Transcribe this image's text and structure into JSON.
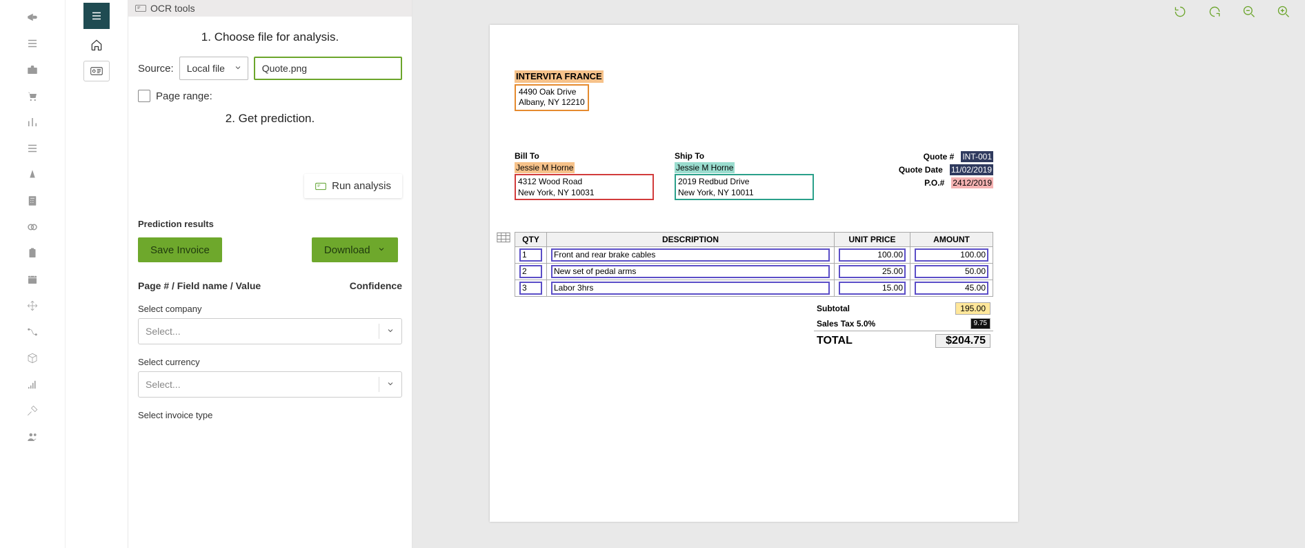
{
  "rail": {
    "icons": [
      "megaphone",
      "list",
      "briefcase",
      "cart",
      "chart",
      "list2",
      "cone",
      "calculator",
      "rings",
      "clipboard",
      "calendar",
      "move",
      "flow",
      "cube",
      "signal",
      "gavel",
      "users"
    ]
  },
  "toolbar": {
    "title": "OCR tools"
  },
  "steps": {
    "choose": "1. Choose file for analysis.",
    "predict": "2. Get prediction."
  },
  "form": {
    "source_label": "Source:",
    "source_value": "Local file",
    "filename": "Quote.png",
    "page_range_label": "Page range:",
    "run_label": "Run analysis",
    "results_label": "Prediction results",
    "save_label": "Save Invoice",
    "download_label": "Download",
    "cols_left": "Page # / Field name / Value",
    "cols_right": "Confidence",
    "field_company_label": "Select company",
    "field_currency_label": "Select currency",
    "field_invoice_type_label": "Select invoice type",
    "select_placeholder": "Select..."
  },
  "doc": {
    "company": "INTERVITA FRANCE",
    "company_addr1": "4490 Oak Drive",
    "company_addr2": "Albany, NY 12210",
    "bill_hdr": "Bill To",
    "bill_name": "Jessie M Horne",
    "bill_addr1": "4312 Wood Road",
    "bill_addr2": "New York, NY 10031",
    "ship_hdr": "Ship To",
    "ship_name": "Jessie M Horne",
    "ship_addr1": "2019 Redbud Drive",
    "ship_addr2": "New York, NY 10011",
    "meta": {
      "quote_no_k": "Quote #",
      "quote_no_v": "INT-001",
      "quote_date_k": "Quote Date",
      "quote_date_v": "11/02/2019",
      "po_k": "P.O.#",
      "po_v": "2412/2019"
    },
    "table": {
      "headers": {
        "qty": "QTY",
        "desc": "DESCRIPTION",
        "unit": "UNIT PRICE",
        "amt": "AMOUNT"
      },
      "rows": [
        {
          "qty": "1",
          "desc": "Front and rear brake cables",
          "unit": "100.00",
          "amt": "100.00"
        },
        {
          "qty": "2",
          "desc": "New set of pedal arms",
          "unit": "25.00",
          "amt": "50.00"
        },
        {
          "qty": "3",
          "desc": "Labor 3hrs",
          "unit": "15.00",
          "amt": "45.00"
        }
      ]
    },
    "totals": {
      "subtotal_k": "Subtotal",
      "subtotal_v": "195.00",
      "tax_k": "Sales Tax 5.0%",
      "tax_v": "9.75",
      "total_k": "TOTAL",
      "total_v": "$204.75"
    }
  }
}
